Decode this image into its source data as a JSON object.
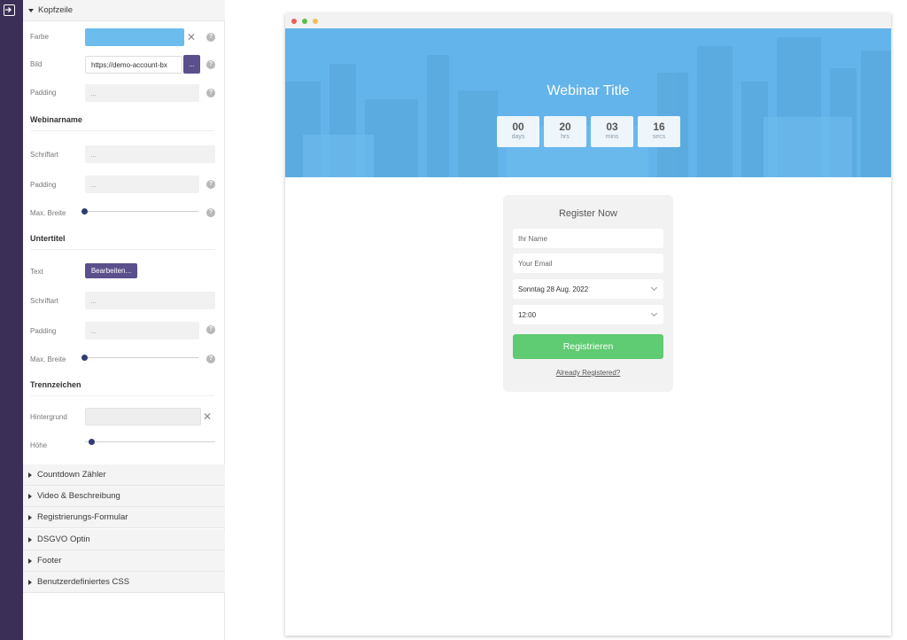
{
  "panel": {
    "header_section": "Kopfzeile",
    "labels": {
      "farbe": "Farbe",
      "bild": "Bild",
      "padding": "Padding",
      "schriftart": "Schriftart",
      "max_breite": "Max. Breite",
      "text": "Text",
      "hintergrund": "Hintergrund",
      "hoehe": "Höhe"
    },
    "bild_value": "https://demo-account-bx",
    "browse_label": "...",
    "placeholder": "...",
    "subheads": {
      "webinarname": "Webinarname",
      "untertitel": "Untertitel",
      "trennzeichen": "Trennzeichen"
    },
    "edit_button": "Bearbeiten...",
    "header_color": "#6cbcee",
    "collapsed_sections": [
      "Countdown Zähler",
      "Video & Beschreibung",
      "Registrierungs-Formular",
      "DSGVO Optin",
      "Footer",
      "Benutzerdefiniertes CSS"
    ]
  },
  "preview": {
    "title": "Webinar Title",
    "countdown": [
      {
        "value": "00",
        "unit": "days"
      },
      {
        "value": "20",
        "unit": "hrs"
      },
      {
        "value": "03",
        "unit": "mins"
      },
      {
        "value": "16",
        "unit": "secs"
      }
    ],
    "form": {
      "title": "Register Now",
      "name_placeholder": "Ihr Name",
      "email_placeholder": "Your Email",
      "date_value": "Sonntag 28 Aug. 2022",
      "time_value": "12:00",
      "submit": "Registrieren",
      "already": "Already Registered?"
    },
    "colors": {
      "hero": "#63b4ea",
      "submit": "#5fcb72",
      "dot_red": "#ec5f57",
      "dot_green": "#5dbf48",
      "dot_yellow": "#f4be4f"
    }
  }
}
